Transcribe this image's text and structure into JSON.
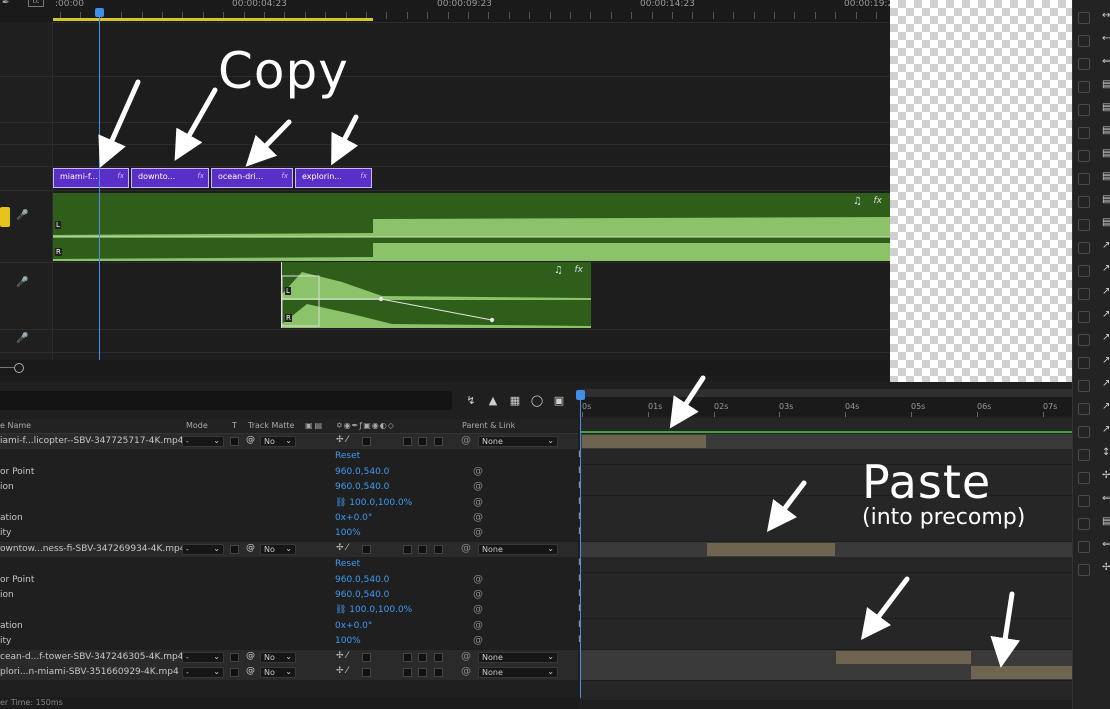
{
  "premiere": {
    "timecodes": [
      ":00:00",
      "00:00:04:23",
      "00:00:09:23",
      "00:00:14:23",
      "00:00:19:2"
    ],
    "video_clips": [
      {
        "label": "miami-f...",
        "fx": "fx"
      },
      {
        "label": "downto...",
        "fx": "fx"
      },
      {
        "label": "ocean-dri...",
        "fx": "fx"
      },
      {
        "label": "explorin...",
        "fx": "fx"
      }
    ],
    "audio_channel_left": "L",
    "audio_channel_right": "R",
    "audio_fx": "fx",
    "audio_note": "♫"
  },
  "ae": {
    "columns": {
      "source_name": "e Name",
      "mode": "Mode",
      "t": "T",
      "track_matte": "Track Matte",
      "parent_link": "Parent & Link"
    },
    "time_labels": [
      "0s",
      "01s",
      "02s",
      "03s",
      "04s",
      "05s",
      "06s",
      "07s"
    ],
    "rows": [
      {
        "kind": "layer",
        "name": "iami-f...licopter--SBV-347725717-4K.mp4",
        "mode": "-",
        "matte": "No",
        "parent": "None"
      },
      {
        "kind": "prop",
        "name": "",
        "value": "Reset"
      },
      {
        "kind": "prop",
        "name": "or Point",
        "value": "960.0,540.0"
      },
      {
        "kind": "prop",
        "name": "ion",
        "value": "960.0,540.0"
      },
      {
        "kind": "prop",
        "name": "",
        "value": "100.0,100.0%"
      },
      {
        "kind": "prop",
        "name": "ation",
        "value": "0x+0.0°"
      },
      {
        "kind": "prop",
        "name": "ity",
        "value": "100%"
      },
      {
        "kind": "layer",
        "name": "owntow...ness-fi-SBV-347269934-4K.mp4",
        "mode": "-",
        "matte": "No",
        "parent": "None"
      },
      {
        "kind": "prop",
        "name": "",
        "value": "Reset"
      },
      {
        "kind": "prop",
        "name": "or Point",
        "value": "960.0,540.0"
      },
      {
        "kind": "prop",
        "name": "ion",
        "value": "960.0,540.0"
      },
      {
        "kind": "prop",
        "name": "",
        "value": "100.0,100.0%"
      },
      {
        "kind": "prop",
        "name": "ation",
        "value": "0x+0.0°"
      },
      {
        "kind": "prop",
        "name": "ity",
        "value": "100%"
      },
      {
        "kind": "layer",
        "name": "cean-d...f-tower-SBV-347246305-4K.mp4",
        "mode": "-",
        "matte": "No",
        "parent": "None"
      },
      {
        "kind": "layer",
        "name": "plori...n-miami-SBV-351660929-4K.mp4",
        "mode": "-",
        "matte": "No",
        "parent": "None"
      }
    ],
    "footer": "er Time: 150ms"
  },
  "annotations": {
    "copy": "Copy",
    "paste": "Paste",
    "paste_sub": "(into precomp)"
  },
  "colors": {
    "clip_purple": "#5a2fc7",
    "audio_green": "#2f5d1a",
    "waveform_green": "#8cc269",
    "playhead_blue": "#4a8ee8",
    "value_blue": "#3f9bf2",
    "layer_bar_tan": "#6e6450"
  }
}
